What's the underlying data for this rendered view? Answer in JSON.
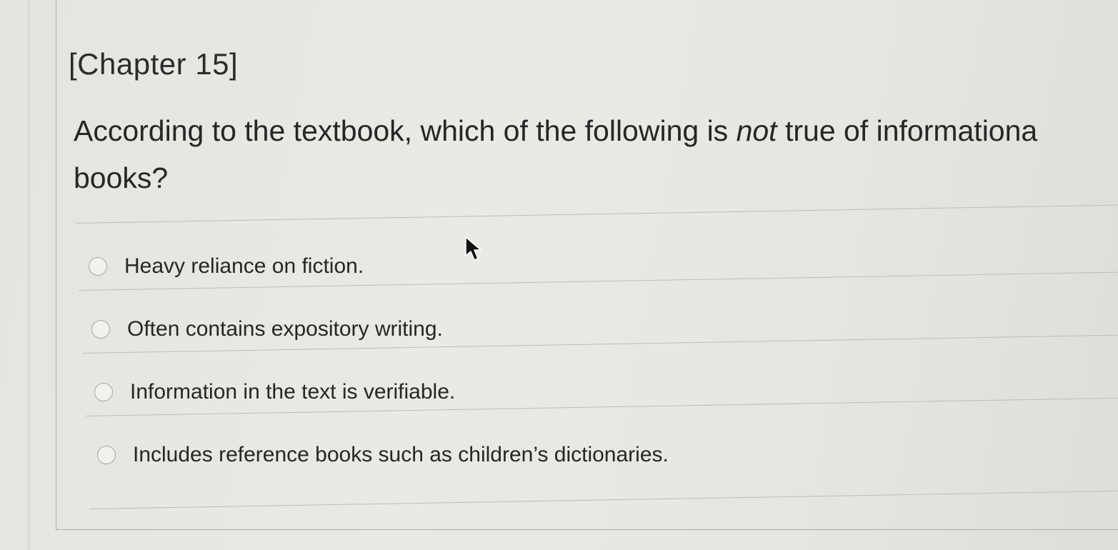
{
  "header": {
    "chapter": "[Chapter 15]"
  },
  "question": {
    "text_before": "According to the textbook, which of the following is ",
    "emphasis": "not",
    "text_after": " true of informationa",
    "line2": "books?"
  },
  "answers": [
    {
      "label": "Heavy reliance on fiction."
    },
    {
      "label": "Often contains expository writing."
    },
    {
      "label": "Information in the text is verifiable."
    },
    {
      "label": "Includes reference books such as children’s dictionaries."
    }
  ]
}
